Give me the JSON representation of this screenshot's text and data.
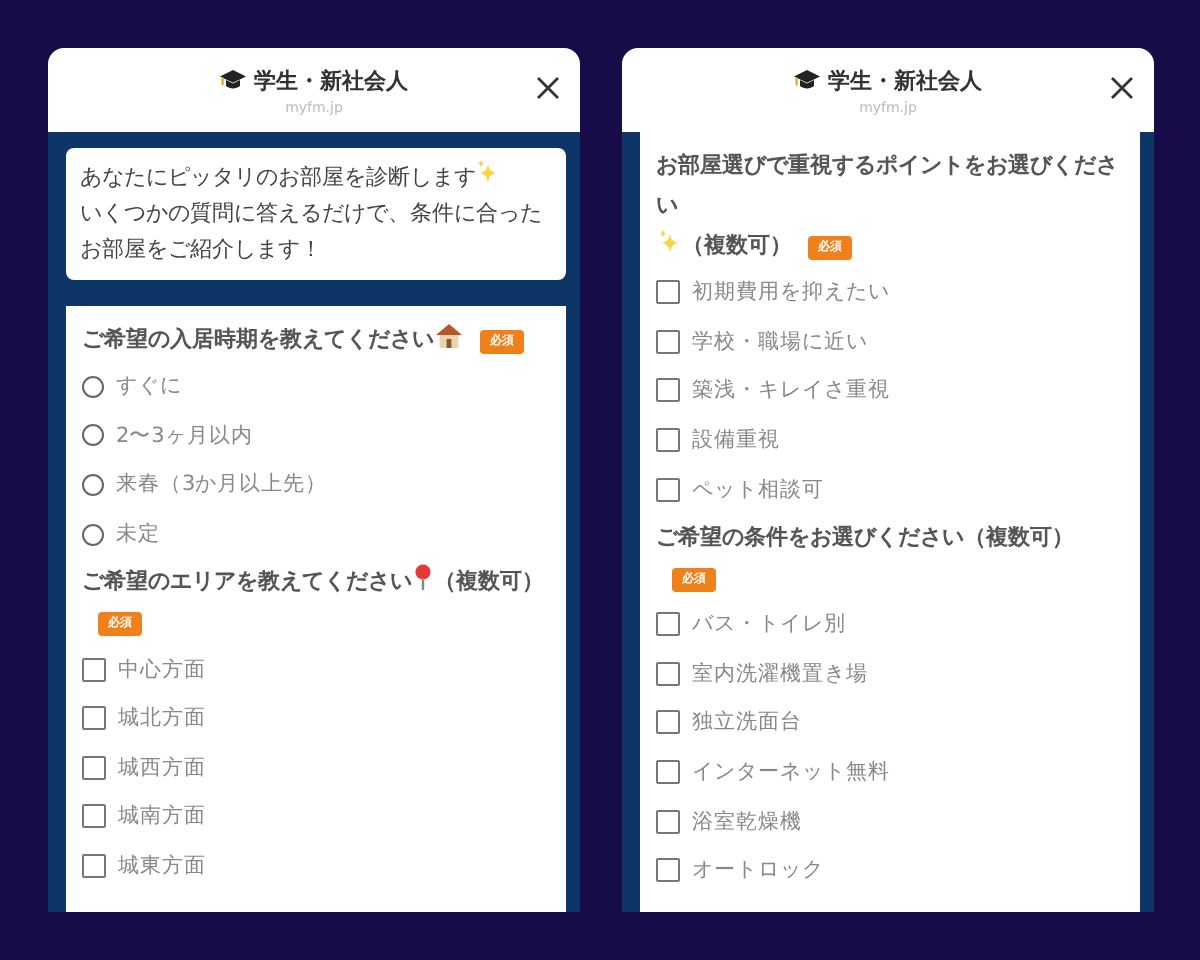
{
  "screens": [
    {
      "header": {
        "title": "学生・新社会人",
        "url": "myfm.jp"
      },
      "intro": {
        "lines": [
          "あなたにピッタリのお部屋を診断します",
          "いくつかの質問に答えるだけで、条件に合ったお部屋をご紹介します！"
        ]
      },
      "questions": [
        {
          "kind": "radio",
          "text": "ご希望の入居時期を教えてください",
          "badge": "必須",
          "options": [
            {
              "label": "すぐに",
              "checked": false
            },
            {
              "label": "2〜3ヶ月以内",
              "checked": false
            },
            {
              "label": "来春（3か月以上先）",
              "checked": false
            },
            {
              "label": "未定",
              "checked": false
            }
          ]
        },
        {
          "kind": "checkbox",
          "text": "ご希望のエリアを教えてください",
          "suffix": "（複数可）",
          "badge": "必須",
          "options": [
            {
              "label": "中心方面",
              "checked": false
            },
            {
              "label": "城北方面",
              "checked": false
            },
            {
              "label": "城西方面",
              "checked": false
            },
            {
              "label": "城南方面",
              "checked": false
            },
            {
              "label": "城東方面",
              "checked": false
            }
          ]
        }
      ]
    },
    {
      "header": {
        "title": "学生・新社会人",
        "url": "myfm.jp"
      },
      "questions": [
        {
          "kind": "checkbox",
          "text": "お部屋選びで重視するポイントをお選びください",
          "suffix": "（複数可）",
          "badge": "必須",
          "options": [
            {
              "label": "初期費用を抑えたい",
              "checked": false
            },
            {
              "label": "学校・職場に近い",
              "checked": false
            },
            {
              "label": "築浅・キレイさ重視",
              "checked": false
            },
            {
              "label": "設備重視",
              "checked": false
            },
            {
              "label": "ペット相談可",
              "checked": false
            }
          ]
        },
        {
          "kind": "checkbox",
          "text": "ご希望の条件をお選びください",
          "suffix": "（複数可）",
          "badge": "必須",
          "options": [
            {
              "label": "バス・トイレ別",
              "checked": false
            },
            {
              "label": "室内洗濯機置き場",
              "checked": false
            },
            {
              "label": "独立洗面台",
              "checked": false
            },
            {
              "label": "インターネット無料",
              "checked": false
            },
            {
              "label": "浴室乾燥機",
              "checked": false
            },
            {
              "label": "オートロック",
              "checked": false
            }
          ]
        }
      ]
    }
  ]
}
